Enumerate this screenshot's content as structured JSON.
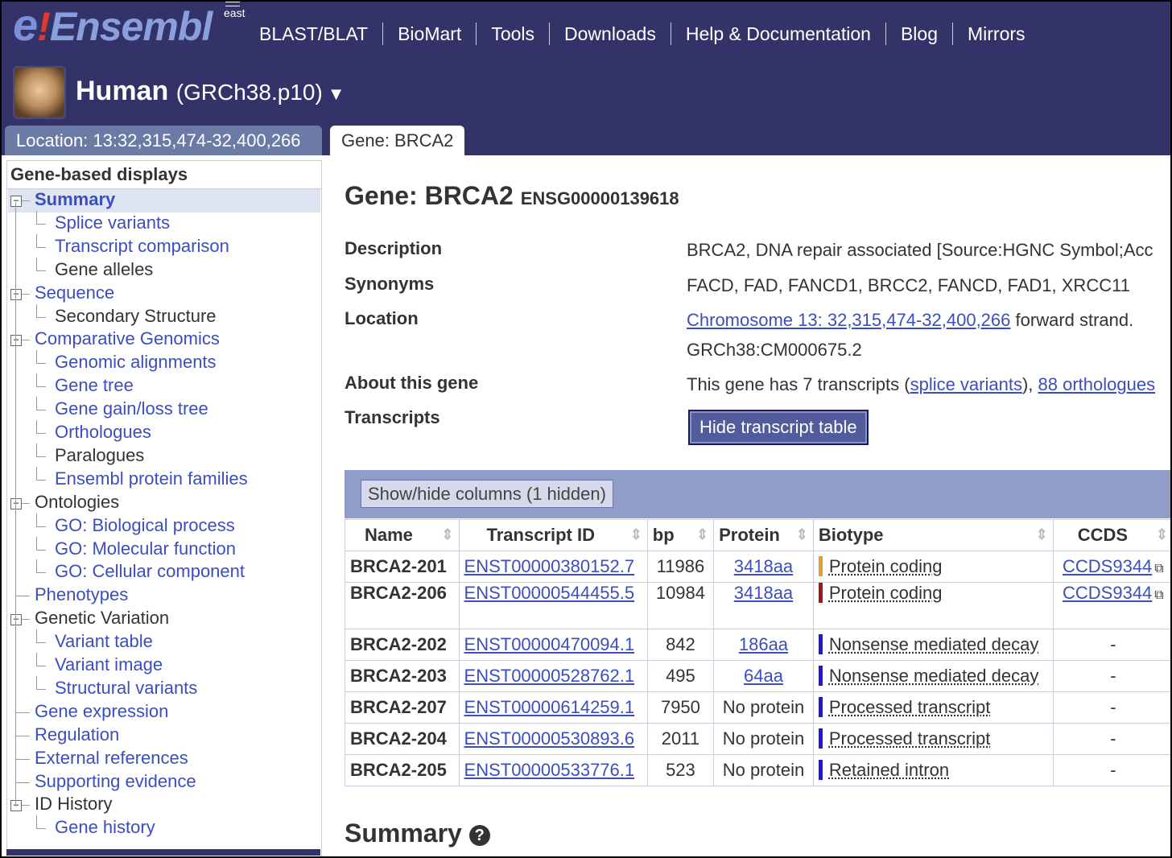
{
  "header": {
    "logo_text": "Ensembl",
    "logo_sup": "east",
    "nav": [
      "BLAST/BLAT",
      "BioMart",
      "Tools",
      "Downloads",
      "Help & Documentation",
      "Blog",
      "Mirrors"
    ],
    "species": "Human",
    "assembly": "(GRCh38.p10)",
    "caret": "▼"
  },
  "tabs": {
    "location": "Location: 13:32,315,474-32,400,266",
    "gene": "Gene: BRCA2"
  },
  "sidebar": {
    "heading": "Gene-based displays",
    "items": [
      {
        "label": "Summary",
        "level": 0,
        "toggle": "⊟"
      },
      {
        "label": "Splice variants",
        "level": 1
      },
      {
        "label": "Transcript comparison",
        "level": 1
      },
      {
        "label": "Gene alleles",
        "level": 1
      },
      {
        "label": "Sequence",
        "level": 0,
        "toggle": "⊟"
      },
      {
        "label": "Secondary Structure",
        "level": 1
      },
      {
        "label": "Comparative Genomics",
        "level": 0,
        "toggle": "⊟"
      },
      {
        "label": "Genomic alignments",
        "level": 1
      },
      {
        "label": "Gene tree",
        "level": 1
      },
      {
        "label": "Gene gain/loss tree",
        "level": 1
      },
      {
        "label": "Orthologues",
        "level": 1
      },
      {
        "label": "Paralogues",
        "level": 1
      },
      {
        "label": "Ensembl protein families",
        "level": 1
      },
      {
        "label": "Ontologies",
        "level": 0,
        "toggle": "⊟"
      },
      {
        "label": "GO: Biological process",
        "level": 1
      },
      {
        "label": "GO: Molecular function",
        "level": 1
      },
      {
        "label": "GO: Cellular component",
        "level": 1
      },
      {
        "label": "Phenotypes",
        "level": 0
      },
      {
        "label": "Genetic Variation",
        "level": 0,
        "toggle": "⊟"
      },
      {
        "label": "Variant table",
        "level": 1
      },
      {
        "label": "Variant image",
        "level": 1
      },
      {
        "label": "Structural variants",
        "level": 1
      },
      {
        "label": "Gene expression",
        "level": 0
      },
      {
        "label": "Regulation",
        "level": 0
      },
      {
        "label": "External references",
        "level": 0
      },
      {
        "label": "Supporting evidence",
        "level": 0
      },
      {
        "label": "ID History",
        "level": 0,
        "toggle": "⊟"
      },
      {
        "label": "Gene history",
        "level": 1
      }
    ]
  },
  "gene": {
    "title": "Gene: BRCA2",
    "stable_id": "ENSG00000139618",
    "description_label": "Description",
    "description": "BRCA2, DNA repair associated [Source:HGNC Symbol;Acc",
    "synonyms_label": "Synonyms",
    "synonyms": "FACD, FAD, FANCD1, BRCC2, FANCD, FAD1, XRCC11",
    "location_label": "Location",
    "location_link": "Chromosome 13: 32,315,474-32,400,266",
    "location_suffix": " forward strand.",
    "location_line2": "GRCh38:CM000675.2",
    "about_label": "About this gene",
    "about_text": "This gene has 7 transcripts (",
    "about_link1": "splice variants",
    "about_mid": "), ",
    "about_link2": "88 orthologues",
    "transcripts_label": "Transcripts",
    "hide_button": "Hide transcript table"
  },
  "table": {
    "show_hide": "Show/hide columns (1 hidden)",
    "headers": [
      "Name",
      "Transcript ID",
      "bp",
      "Protein",
      "Biotype",
      "CCDS"
    ],
    "sort_icon": "▲▼",
    "rows": [
      {
        "name": "BRCA2-201",
        "id": "ENST00000380152.7",
        "bp": "11986",
        "protein": "3418aa",
        "protein_link": true,
        "biotype": "Protein coding",
        "bio_color": "#e0a030",
        "ccds": "CCDS9344",
        "ccds_link": true
      },
      {
        "name": "BRCA2-206",
        "id": "ENST00000544455.5",
        "bp": "10984",
        "protein": "3418aa",
        "protein_link": true,
        "biotype": "Protein coding",
        "bio_color": "#9a1a1a",
        "ccds": "CCDS9344",
        "ccds_link": true
      },
      {
        "name": "BRCA2-202",
        "id": "ENST00000470094.1",
        "bp": "842",
        "protein": "186aa",
        "protein_link": true,
        "biotype": "Nonsense mediated decay",
        "bio_color": "#1a1ad0",
        "ccds": "-",
        "ccds_link": false
      },
      {
        "name": "BRCA2-203",
        "id": "ENST00000528762.1",
        "bp": "495",
        "protein": "64aa",
        "protein_link": true,
        "biotype": "Nonsense mediated decay",
        "bio_color": "#1a1ad0",
        "ccds": "-",
        "ccds_link": false
      },
      {
        "name": "BRCA2-207",
        "id": "ENST00000614259.1",
        "bp": "7950",
        "protein": "No protein",
        "protein_link": false,
        "biotype": "Processed transcript",
        "bio_color": "#1a1ad0",
        "ccds": "-",
        "ccds_link": false
      },
      {
        "name": "BRCA2-204",
        "id": "ENST00000530893.6",
        "bp": "2011",
        "protein": "No protein",
        "protein_link": false,
        "biotype": "Processed transcript",
        "bio_color": "#1a1ad0",
        "ccds": "-",
        "ccds_link": false
      },
      {
        "name": "BRCA2-205",
        "id": "ENST00000533776.1",
        "bp": "523",
        "protein": "No protein",
        "protein_link": false,
        "biotype": "Retained intron",
        "bio_color": "#1a1ad0",
        "ccds": "-",
        "ccds_link": false
      }
    ]
  },
  "summary_heading": "Summary",
  "help_icon": "?",
  "external_icon": "⧉"
}
